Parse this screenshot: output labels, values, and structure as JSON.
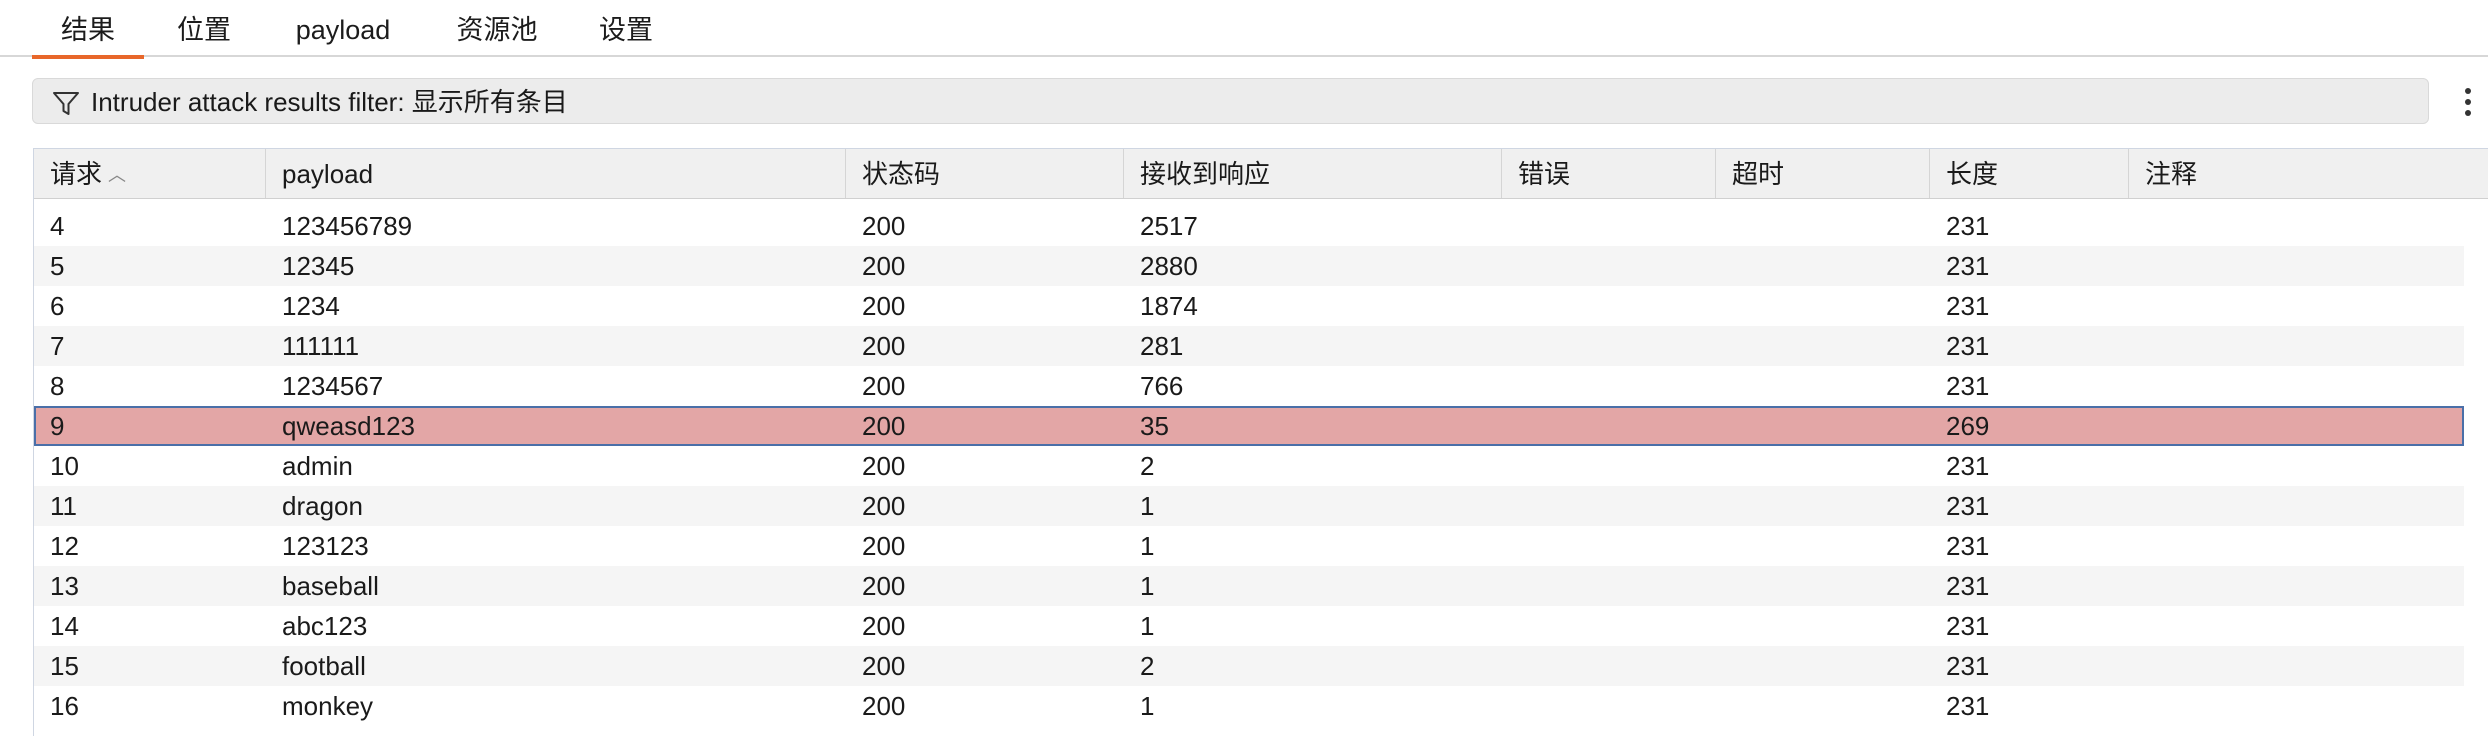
{
  "tabs": [
    {
      "label": "结果",
      "active": true
    },
    {
      "label": "位置",
      "active": false
    },
    {
      "label": "payload",
      "active": false
    },
    {
      "label": "资源池",
      "active": false
    },
    {
      "label": "设置",
      "active": false
    }
  ],
  "filter": {
    "icon": "filter-icon",
    "text": "Intruder attack results filter: 显示所有条目"
  },
  "menu_icon": "kebab-menu-icon",
  "table": {
    "columns": [
      "请求",
      "payload",
      "状态码",
      "接收到响应",
      "错误",
      "超时",
      "长度",
      "注释"
    ],
    "sort_column": "请求",
    "sort_direction": "ascending",
    "rows": [
      {
        "request": "4",
        "payload": "123456789",
        "status": "200",
        "received": "2517",
        "error": "",
        "timeout": "",
        "length": "231",
        "comment": ""
      },
      {
        "request": "5",
        "payload": "12345",
        "status": "200",
        "received": "2880",
        "error": "",
        "timeout": "",
        "length": "231",
        "comment": ""
      },
      {
        "request": "6",
        "payload": "1234",
        "status": "200",
        "received": "1874",
        "error": "",
        "timeout": "",
        "length": "231",
        "comment": ""
      },
      {
        "request": "7",
        "payload": "111111",
        "status": "200",
        "received": "281",
        "error": "",
        "timeout": "",
        "length": "231",
        "comment": ""
      },
      {
        "request": "8",
        "payload": "1234567",
        "status": "200",
        "received": "766",
        "error": "",
        "timeout": "",
        "length": "231",
        "comment": ""
      },
      {
        "request": "9",
        "payload": "qweasd123",
        "status": "200",
        "received": "35",
        "error": "",
        "timeout": "",
        "length": "269",
        "comment": "",
        "selected": true
      },
      {
        "request": "10",
        "payload": "admin",
        "status": "200",
        "received": "2",
        "error": "",
        "timeout": "",
        "length": "231",
        "comment": ""
      },
      {
        "request": "11",
        "payload": "dragon",
        "status": "200",
        "received": "1",
        "error": "",
        "timeout": "",
        "length": "231",
        "comment": ""
      },
      {
        "request": "12",
        "payload": "123123",
        "status": "200",
        "received": "1",
        "error": "",
        "timeout": "",
        "length": "231",
        "comment": ""
      },
      {
        "request": "13",
        "payload": "baseball",
        "status": "200",
        "received": "1",
        "error": "",
        "timeout": "",
        "length": "231",
        "comment": ""
      },
      {
        "request": "14",
        "payload": "abc123",
        "status": "200",
        "received": "1",
        "error": "",
        "timeout": "",
        "length": "231",
        "comment": ""
      },
      {
        "request": "15",
        "payload": "football",
        "status": "200",
        "received": "2",
        "error": "",
        "timeout": "",
        "length": "231",
        "comment": ""
      },
      {
        "request": "16",
        "payload": "monkey",
        "status": "200",
        "received": "1",
        "error": "",
        "timeout": "",
        "length": "231",
        "comment": ""
      }
    ]
  },
  "colors": {
    "accent": "#e8672a",
    "selected_row": "#e3a6a6",
    "selected_outline": "#4a6fa8"
  }
}
